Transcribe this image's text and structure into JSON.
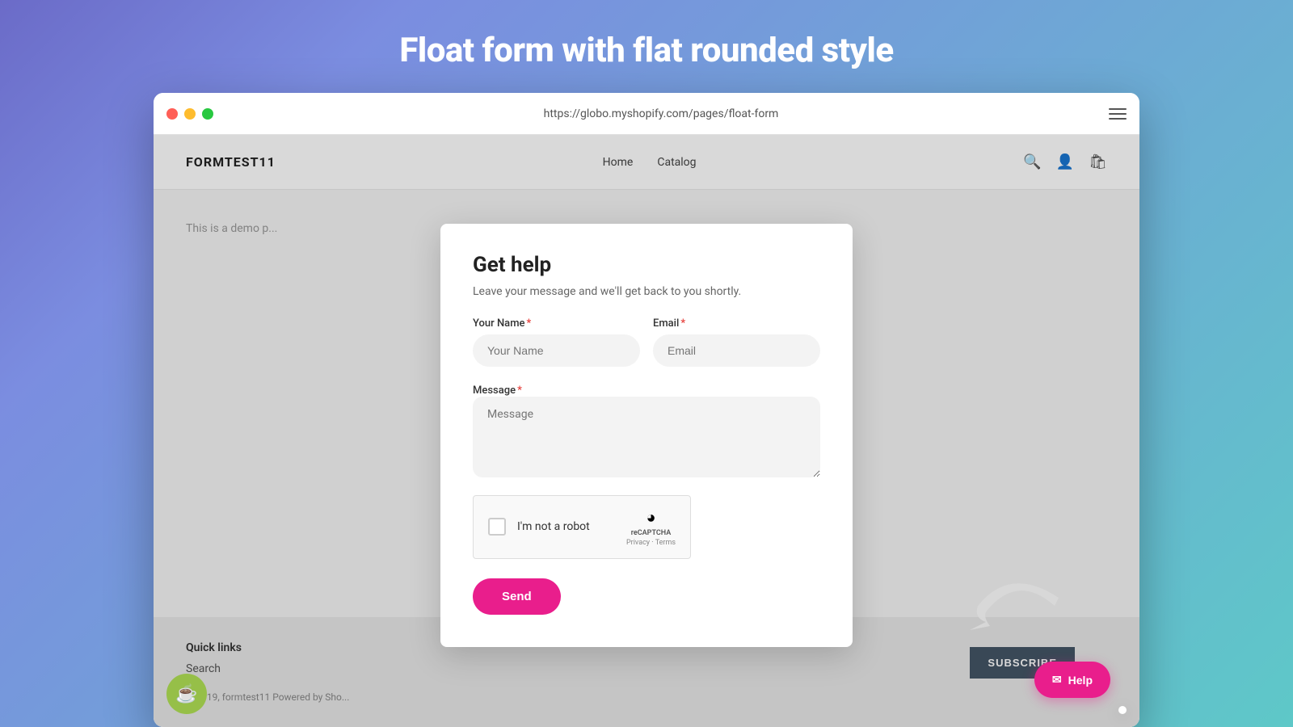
{
  "page": {
    "title": "Float form with flat rounded style"
  },
  "browser": {
    "url": "https://globo.myshopify.com/pages/float-form",
    "traffic_lights": [
      "red",
      "yellow",
      "green"
    ]
  },
  "site": {
    "logo": "FORMTEST11",
    "nav": [
      "Home",
      "Catalog"
    ],
    "demo_text": "This is a demo p...",
    "footer": {
      "quick_links_title": "Quick links",
      "search_link": "Search",
      "copyright": "© 2019, formtest11 Powered by Sho..."
    },
    "subscribe_btn": "SUBSCRIBE"
  },
  "modal": {
    "title": "Get help",
    "subtitle": "Leave your message and we'll get back to you shortly.",
    "fields": {
      "name_label": "Your Name",
      "name_placeholder": "Your Name",
      "email_label": "Email",
      "email_placeholder": "Email",
      "message_label": "Message",
      "message_placeholder": "Message"
    },
    "captcha": {
      "label": "I'm not a robot",
      "brand": "reCAPTCHA",
      "links": "Privacy · Terms"
    },
    "send_btn": "Send"
  },
  "help_btn": {
    "label": "Help"
  },
  "colors": {
    "primary_pink": "#e91e8c",
    "bg_gradient_start": "#6b6bc8",
    "bg_gradient_end": "#5ec8c8"
  }
}
